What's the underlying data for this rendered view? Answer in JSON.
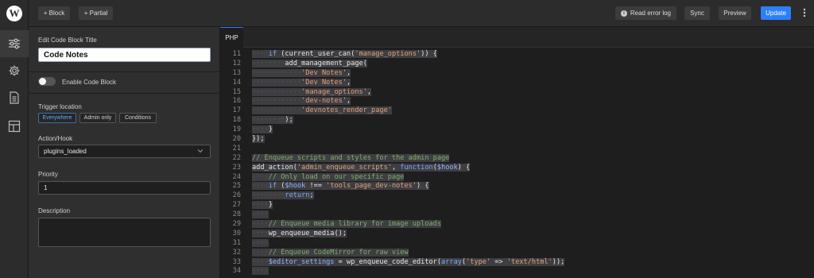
{
  "toolbar": {
    "add_block": "+ Block",
    "add_partial": "+ Partial",
    "read_error_log": "Read error log",
    "sync": "Sync",
    "preview": "Preview",
    "update": "Update"
  },
  "rail": {
    "icons": [
      "sliders-icon",
      "gear-icon",
      "document-icon",
      "layout-icon"
    ]
  },
  "panel": {
    "title_label": "Edit Code Block Title",
    "title_value": "Code Notes",
    "enable_label": "Enable Code Block",
    "enabled": false,
    "trigger_label": "Trigger location",
    "trigger_options": [
      "Everywhere",
      "Admin only",
      "Conditions"
    ],
    "trigger_selected": "Everywhere",
    "hook_label": "Action/Hook",
    "hook_value": "plugins_loaded",
    "priority_label": "Priority",
    "priority_value": "1",
    "description_label": "Description",
    "description_value": ""
  },
  "editor": {
    "tab": "PHP",
    "lines": [
      {
        "n": "11",
        "code": "····if (current_user_can('manage_options')) {"
      },
      {
        "n": "12",
        "code": "········add_management_page("
      },
      {
        "n": "13",
        "code": "············'Dev Notes',"
      },
      {
        "n": "14",
        "code": "············'Dev Notes',"
      },
      {
        "n": "15",
        "code": "············'manage_options',"
      },
      {
        "n": "16",
        "code": "············'dev-notes',"
      },
      {
        "n": "17",
        "code": "············'devnotes_render_page'"
      },
      {
        "n": "18",
        "code": "········);"
      },
      {
        "n": "19",
        "code": "····}"
      },
      {
        "n": "20",
        "code": "});"
      },
      {
        "n": "21",
        "code": ""
      },
      {
        "n": "22",
        "code": "// Enqueue scripts and styles for the admin page"
      },
      {
        "n": "23",
        "code": "add_action('admin_enqueue_scripts', function($hook) {"
      },
      {
        "n": "24",
        "code": "····// Only load on our specific page"
      },
      {
        "n": "25",
        "code": "····if ($hook !== 'tools_page_dev-notes') {"
      },
      {
        "n": "26",
        "code": "········return;"
      },
      {
        "n": "27",
        "code": "····}"
      },
      {
        "n": "28",
        "code": "····"
      },
      {
        "n": "29",
        "code": "····// Enqueue media library for image uploads"
      },
      {
        "n": "30",
        "code": "····wp_enqueue_media();"
      },
      {
        "n": "31",
        "code": "····"
      },
      {
        "n": "32",
        "code": "····// Enqueue CodeMirror for raw view"
      },
      {
        "n": "33",
        "code": "····$editor_settings = wp_enqueue_code_editor(array('type' => 'text/html'));"
      },
      {
        "n": "34",
        "code": "····"
      }
    ]
  },
  "colors": {
    "accent": "#2d7ff9",
    "string": "#e4a07a",
    "keyword": "#79a8ff",
    "comment": "#7fae6a"
  }
}
